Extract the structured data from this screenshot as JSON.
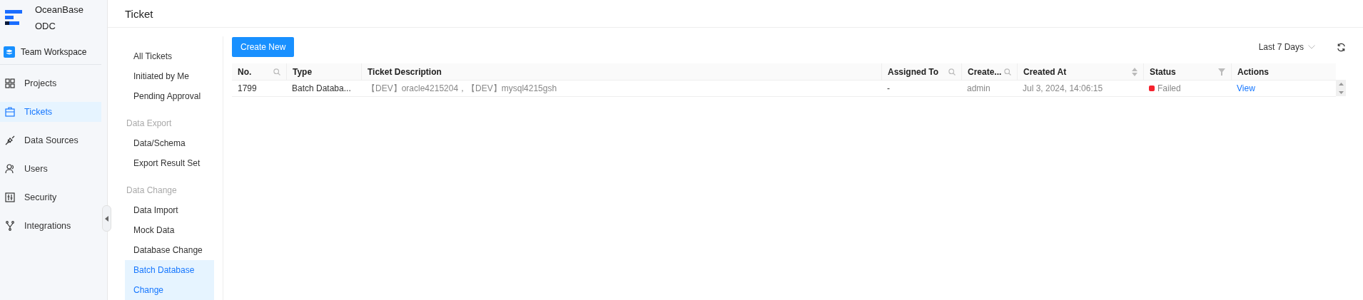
{
  "brand": {
    "name": "OceanBase",
    "product": "ODC"
  },
  "workspace": "Team Workspace",
  "nav": [
    {
      "label": "Projects",
      "selected": false
    },
    {
      "label": "Tickets",
      "selected": true
    },
    {
      "label": "Data Sources",
      "selected": false
    },
    {
      "label": "Users",
      "selected": false
    },
    {
      "label": "Security",
      "selected": false
    },
    {
      "label": "Integrations",
      "selected": false
    }
  ],
  "page_title": "Ticket",
  "submenu": [
    {
      "kind": "item",
      "label": "All Tickets",
      "selected": false
    },
    {
      "kind": "item",
      "label": "Initiated by Me",
      "selected": false
    },
    {
      "kind": "item",
      "label": "Pending Approval",
      "selected": false
    },
    {
      "kind": "group",
      "label": "Data Export"
    },
    {
      "kind": "item",
      "label": "Data/Schema",
      "selected": false
    },
    {
      "kind": "item",
      "label": "Export Result Set",
      "selected": false
    },
    {
      "kind": "group",
      "label": "Data Change"
    },
    {
      "kind": "item",
      "label": "Data Import",
      "selected": false
    },
    {
      "kind": "item",
      "label": "Mock Data",
      "selected": false
    },
    {
      "kind": "item",
      "label": "Database Change",
      "selected": false
    },
    {
      "kind": "item",
      "label": "Batch Database Change",
      "selected": true
    }
  ],
  "create_button": "Create New",
  "range": "Last 7 Days",
  "table": {
    "columns": [
      "No.",
      "Type",
      "Ticket Description",
      "Assigned To",
      "Create...",
      "Created At",
      "Status",
      "Actions"
    ],
    "rows": [
      {
        "no": "1799",
        "type": "Batch Databa...",
        "description": "【DEV】oracle4215204，【DEV】mysql4215gsh",
        "assigned": "-",
        "creator": "admin",
        "created_at": "Jul 3, 2024, 14:06:15",
        "status": "Failed",
        "color": "#f5222d",
        "action": "View"
      }
    ]
  }
}
